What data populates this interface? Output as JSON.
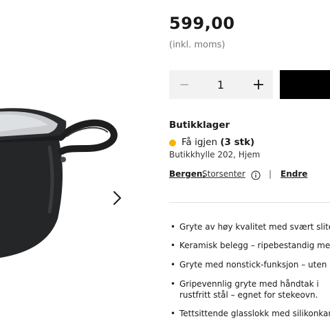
{
  "product": {
    "price": "599,00",
    "vat_note": "(inkl. moms)",
    "image_icon": "cooking-pot-with-lid-photo",
    "next_icon": "chevron-right-icon"
  },
  "quantity": {
    "minus_label": "−",
    "value": "1",
    "plus_label": "+"
  },
  "colors": {
    "accent": "#000000",
    "stock_dot": "#f5b400",
    "stepper_bg": "#f2f2f2"
  },
  "stock": {
    "heading": "Butikklager",
    "status": "Få igjen",
    "count": "(3 stk)",
    "shelf": "Butikkhylle 202, Hjem"
  },
  "store": {
    "city": "Bergen,",
    "name": "Storsenter",
    "separator": "|",
    "change_label": "Endre"
  },
  "features": [
    "Gryte av høy kvalitet med svært slitesterk",
    "Keramisk belegg – ripebestandig med",
    "Gryte med nonstick-funksjon – uten pe",
    "Gripevennlig gryte med håndtak i rustfritt stål – egnet for stekeovn.",
    "Tettsittende glasslokk med silikonkant."
  ]
}
